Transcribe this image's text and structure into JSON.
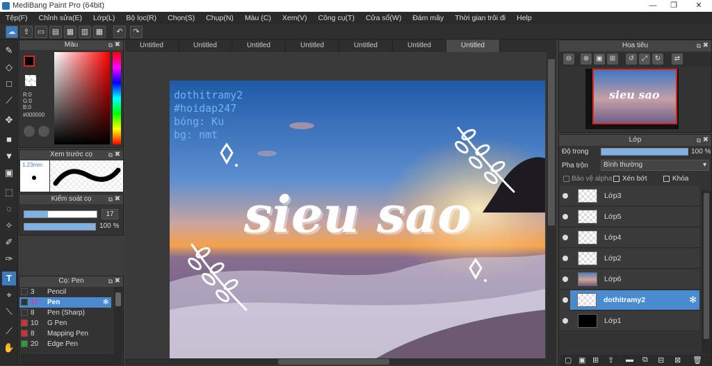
{
  "app": {
    "title": "MediBang Paint Pro (64bit)"
  },
  "menu": [
    "Tệp(F)",
    "Chỉnh sửa(E)",
    "Lớp(L)",
    "Bộ lọc(R)",
    "Chọn(S)",
    "Chụp(N)",
    "Màu (C)",
    "Xem(V)",
    "Công cụ(T)",
    "Cửa sổ(W)",
    "Đám mây",
    "Thời gian trôi đi",
    "Help"
  ],
  "tabs": [
    "Untitled",
    "Untitled",
    "Untitled",
    "Untitled",
    "Untitled",
    "Untitled",
    "Untitled"
  ],
  "color_panel": {
    "title": "Màu",
    "r": "R:0",
    "g": "G:0",
    "b": "B:0",
    "hex": "#000000"
  },
  "preview_panel": {
    "title": "Xem trước cọ",
    "size": "1.23mm"
  },
  "control_panel": {
    "title": "Kiểm soát cọ",
    "size": "17",
    "opacity": "100 %"
  },
  "brush_panel": {
    "title": "Cọ: Pen",
    "items": [
      {
        "num": "3",
        "label": "Pencil",
        "color": "#333333"
      },
      {
        "num": "17",
        "label": "Pen",
        "color": "#333333"
      },
      {
        "num": "8",
        "label": "Pen (Sharp)",
        "color": "#333333"
      },
      {
        "num": "10",
        "label": "G Pen",
        "color": "#d32f2f"
      },
      {
        "num": "8",
        "label": "Mapping Pen",
        "color": "#d32f2f"
      },
      {
        "num": "20",
        "label": "Edge Pen",
        "color": "#2e9e2e"
      }
    ]
  },
  "navigator": {
    "title": "Hoa tiêu"
  },
  "layer_panel": {
    "title": "Lớp",
    "opacity_label": "Độ trong",
    "opacity_value": "100 %",
    "blend_label": "Pha trộn",
    "blend_value": "Bình thường",
    "protect_alpha": "Bảo vệ alpha",
    "clip": "Xén bớt",
    "lock": "Khóa",
    "layers": [
      "Lớp3",
      "Lớp5",
      "Lớp4",
      "Lớp2",
      "Lớp6",
      "dothitramy2",
      "Lớp1"
    ]
  },
  "canvas_text": {
    "l1": "dothitramy2",
    "l2": "#hoidap247",
    "l3": "bóng: Ku",
    "l4": "bg: nmt",
    "main": "sieu sao"
  }
}
